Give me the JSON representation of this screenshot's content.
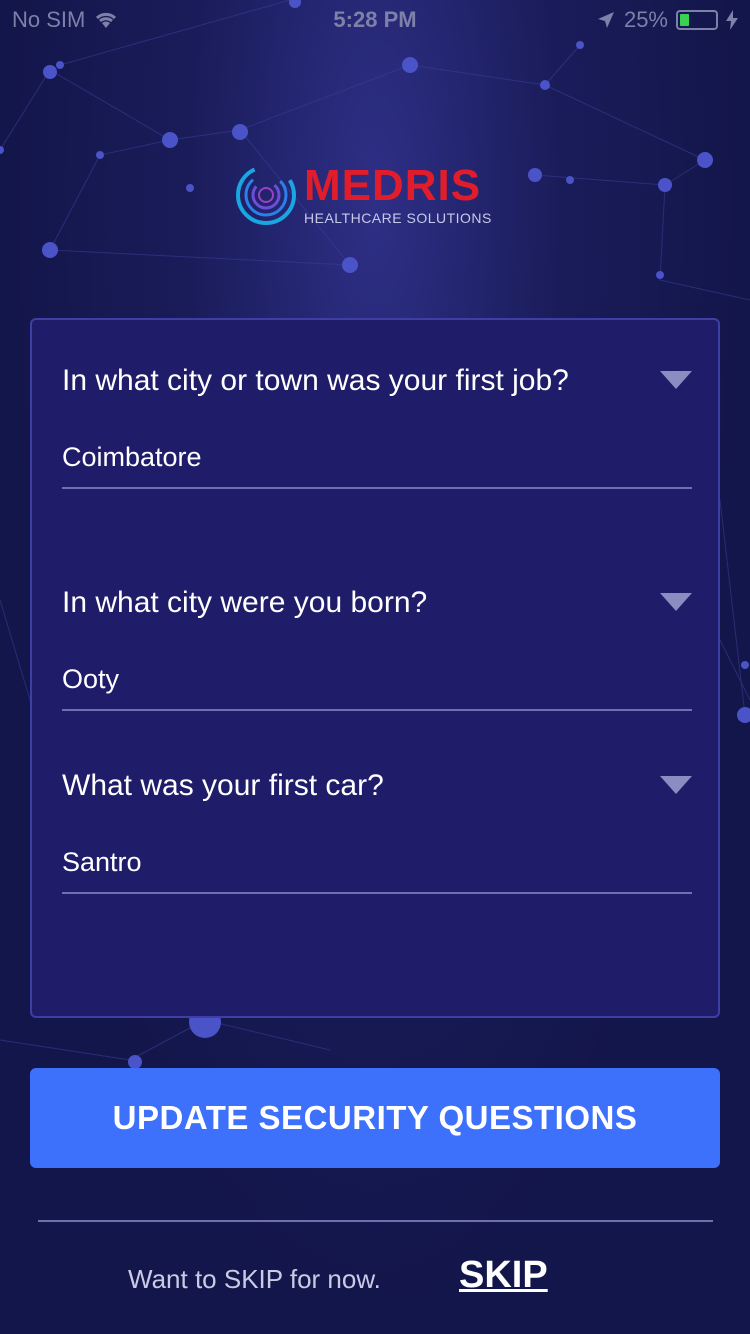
{
  "status_bar": {
    "carrier": "No SIM",
    "time": "5:28 PM",
    "battery_text": "25%",
    "battery_level": 0.25,
    "icons": [
      "wifi-icon",
      "location-arrow-icon",
      "battery-icon",
      "charging-bolt-icon"
    ]
  },
  "logo": {
    "name": "MEDRIS",
    "subtitle": "HEALTHCARE SOLUTIONS"
  },
  "security_questions": [
    {
      "question": "In what city or town was your first job?",
      "answer": "Coimbatore"
    },
    {
      "question": "In what city were you born?",
      "answer": "Ooty"
    },
    {
      "question": "What was your first car?",
      "answer": "Santro"
    }
  ],
  "actions": {
    "update_label": "UPDATE SECURITY QUESTIONS",
    "skip_prompt": "Want to SKIP for now.",
    "skip_label": "SKIP"
  },
  "colors": {
    "background": "#13164a",
    "card": "#1f1c6a",
    "button": "#3d71fb",
    "brand_red": "#e11d2b",
    "battery": "#39d353"
  }
}
